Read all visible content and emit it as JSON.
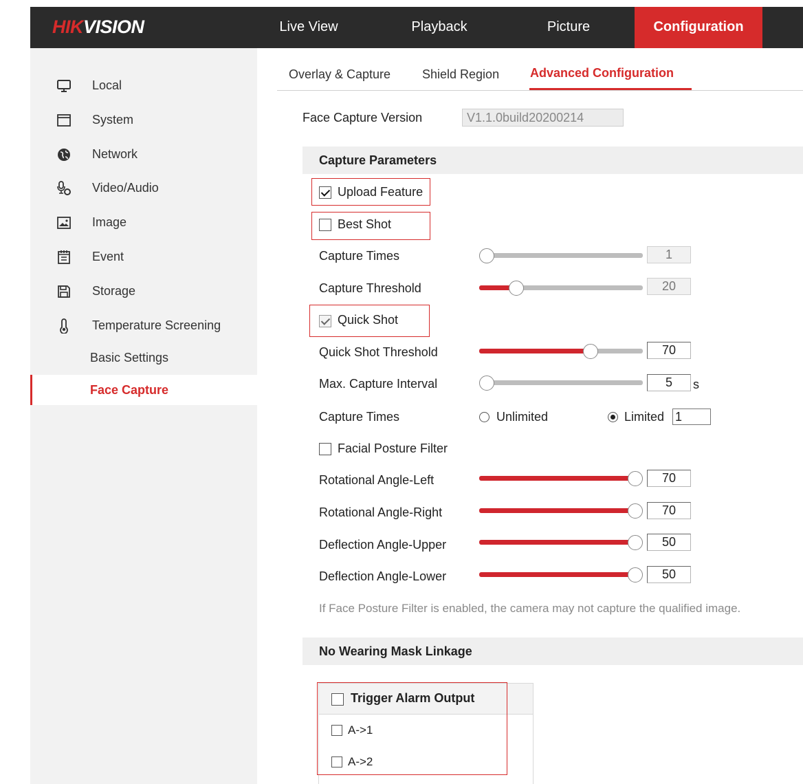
{
  "logo": {
    "part1": "HIK",
    "part2": "VISION"
  },
  "nav": [
    {
      "label": "Live View"
    },
    {
      "label": "Playback"
    },
    {
      "label": "Picture"
    },
    {
      "label": "Configuration",
      "active": true
    }
  ],
  "sidebar": {
    "items": [
      {
        "label": "Local",
        "icon": "monitor-icon"
      },
      {
        "label": "System",
        "icon": "window-icon"
      },
      {
        "label": "Network",
        "icon": "globe-icon"
      },
      {
        "label": "Video/Audio",
        "icon": "microphone-camera-icon"
      },
      {
        "label": "Image",
        "icon": "picture-icon"
      },
      {
        "label": "Event",
        "icon": "calendar-icon"
      },
      {
        "label": "Storage",
        "icon": "floppy-disk-icon"
      },
      {
        "label": "Temperature Screening",
        "icon": "thermometer-icon"
      }
    ],
    "subitems": [
      {
        "label": "Basic Settings"
      },
      {
        "label": "Face Capture",
        "active": true
      }
    ]
  },
  "tabs": [
    {
      "label": "Overlay & Capture"
    },
    {
      "label": "Shield Region"
    },
    {
      "label": "Advanced Configuration",
      "active": true
    }
  ],
  "version": {
    "label": "Face Capture Version",
    "value": "V1.1.0build20200214"
  },
  "capture_params": {
    "title": "Capture Parameters",
    "upload_feature": {
      "label": "Upload Feature",
      "checked": true
    },
    "best_shot": {
      "label": "Best Shot",
      "checked": false
    },
    "capture_times": {
      "label": "Capture Times",
      "value": "1",
      "fraction": 0.0
    },
    "capture_threshold": {
      "label": "Capture Threshold",
      "value": "20",
      "fraction": 0.2
    },
    "quick_shot": {
      "label": "Quick Shot",
      "checked": true
    },
    "quick_shot_threshold": {
      "label": "Quick Shot Threshold",
      "value": "70",
      "fraction": 0.7
    },
    "max_capture_interval": {
      "label": "Max. Capture Interval",
      "value": "5",
      "unit": "s",
      "fraction": 0.0
    },
    "capture_times_mode": {
      "label": "Capture Times",
      "unlimited": "Unlimited",
      "limited": "Limited",
      "selected": "limited",
      "limited_value": "1"
    },
    "facial_posture_filter": {
      "label": "Facial Posture Filter",
      "checked": false
    },
    "rot_left": {
      "label": "Rotational Angle-Left",
      "value": "70",
      "fraction": 1.0
    },
    "rot_right": {
      "label": "Rotational Angle-Right",
      "value": "70",
      "fraction": 1.0
    },
    "def_upper": {
      "label": "Deflection Angle-Upper",
      "value": "50",
      "fraction": 1.0
    },
    "def_lower": {
      "label": "Deflection Angle-Lower",
      "value": "50",
      "fraction": 1.0
    },
    "note": "If Face Posture Filter is enabled, the camera may not capture the qualified image."
  },
  "mask_linkage": {
    "title": "No Wearing Mask Linkage",
    "trigger_alarm_output": "Trigger Alarm Output",
    "outputs": [
      {
        "label": "A->1"
      },
      {
        "label": "A->2"
      }
    ]
  },
  "colors": {
    "accent": "#d62b2b",
    "topbar": "#2b2b2b",
    "sidebar": "#f2f2f2"
  }
}
